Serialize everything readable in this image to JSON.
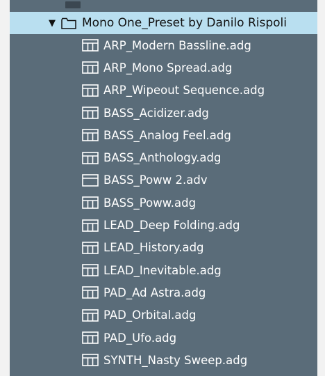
{
  "browser": {
    "folder": {
      "label": "Mono One_Preset by Danilo Rispoli",
      "expanded_glyph": "▼",
      "icon": "folder-icon"
    },
    "files": [
      {
        "label": "ARP_Modern Bassline.adg",
        "icon": "rack-icon"
      },
      {
        "label": "ARP_Mono Spread.adg",
        "icon": "rack-icon"
      },
      {
        "label": "ARP_Wipeout Sequence.adg",
        "icon": "rack-icon"
      },
      {
        "label": "BASS_Acidizer.adg",
        "icon": "rack-icon"
      },
      {
        "label": "BASS_Analog Feel.adg",
        "icon": "rack-icon"
      },
      {
        "label": "BASS_Anthology.adg",
        "icon": "rack-icon"
      },
      {
        "label": "BASS_Poww 2.adv",
        "icon": "preset-icon"
      },
      {
        "label": "BASS_Poww.adg",
        "icon": "rack-icon"
      },
      {
        "label": "LEAD_Deep Folding.adg",
        "icon": "rack-icon"
      },
      {
        "label": "LEAD_History.adg",
        "icon": "rack-icon"
      },
      {
        "label": "LEAD_Inevitable.adg",
        "icon": "rack-icon"
      },
      {
        "label": "PAD_Ad Astra.adg",
        "icon": "rack-icon"
      },
      {
        "label": "PAD_Orbital.adg",
        "icon": "rack-icon"
      },
      {
        "label": "PAD_Ufo.adg",
        "icon": "rack-icon"
      },
      {
        "label": "SYNTH_Nasty Sweep.adg",
        "icon": "rack-icon"
      }
    ]
  },
  "colors": {
    "panel_bg": "#5a6c79",
    "selected_bg": "#b9dff0",
    "text_light": "#ffffff",
    "text_dark": "#111111"
  }
}
